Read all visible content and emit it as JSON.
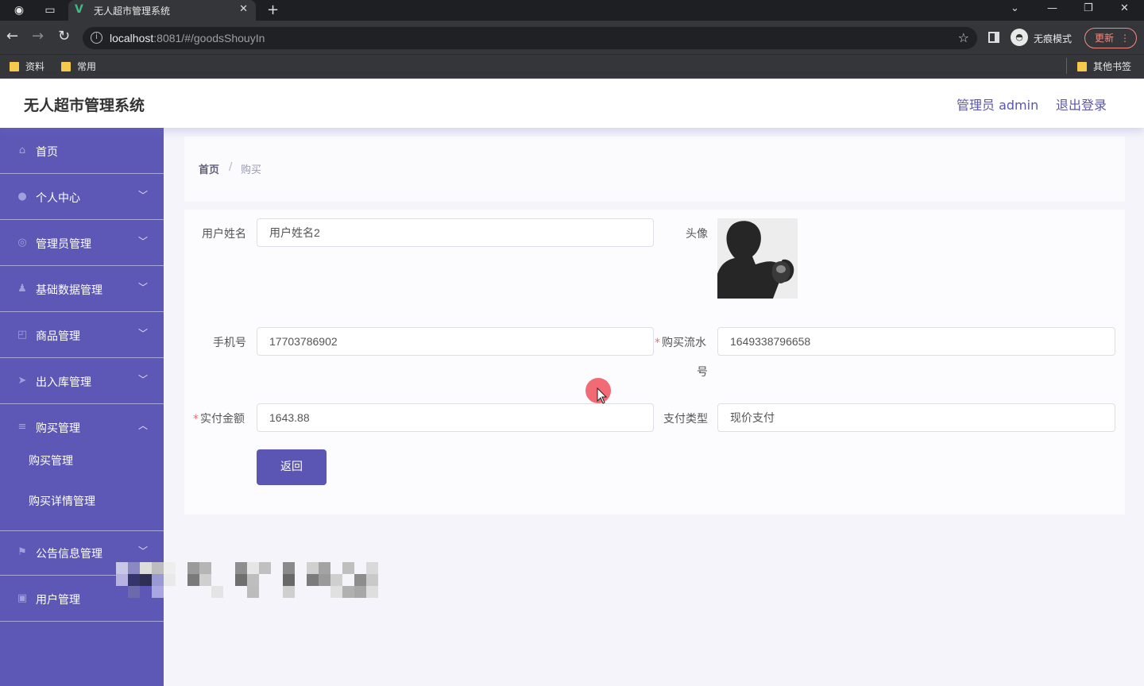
{
  "browser": {
    "tab_title": "无人超市管理系统",
    "url_host": "localhost",
    "url_rest": ":8081/#/goodsShouyIn",
    "incognito_label": "无痕模式",
    "update_label": "更新",
    "bookmarks": [
      "资料",
      "常用"
    ],
    "other_bookmarks": "其他书签"
  },
  "header": {
    "title": "无人超市管理系统",
    "admin_label": "管理员 admin",
    "logout": "退出登录"
  },
  "sidebar": {
    "items": [
      {
        "label": "首页",
        "icon": "home-icon"
      },
      {
        "label": "个人中心",
        "icon": "user-icon"
      },
      {
        "label": "管理员管理",
        "icon": "admin-icon"
      },
      {
        "label": "基础数据管理",
        "icon": "data-icon"
      },
      {
        "label": "商品管理",
        "icon": "goods-icon"
      },
      {
        "label": "出入库管理",
        "icon": "send-icon"
      },
      {
        "label": "购买管理",
        "icon": "list-icon"
      },
      {
        "label": "公告信息管理",
        "icon": "flag-icon"
      },
      {
        "label": "用户管理",
        "icon": "clipboard-icon"
      }
    ],
    "submenu": [
      "购买管理",
      "购买详情管理"
    ]
  },
  "breadcrumb": {
    "home": "首页",
    "separator": "/",
    "current": "购买"
  },
  "form": {
    "username_label": "用户姓名",
    "username_value": "用户姓名2",
    "avatar_label": "头像",
    "phone_label": "手机号",
    "phone_value": "17703786902",
    "serial_label_line1": "购买流水",
    "serial_label_line2": "号",
    "serial_value": "1649338796658",
    "amount_label": "实付金额",
    "amount_value": "1643.88",
    "paytype_label": "支付类型",
    "paytype_value": "现价支付",
    "back_button": "返回"
  },
  "colors": {
    "sidebar": "#5d58b6",
    "accent": "#5b56b4",
    "required": "#f56c6c"
  }
}
